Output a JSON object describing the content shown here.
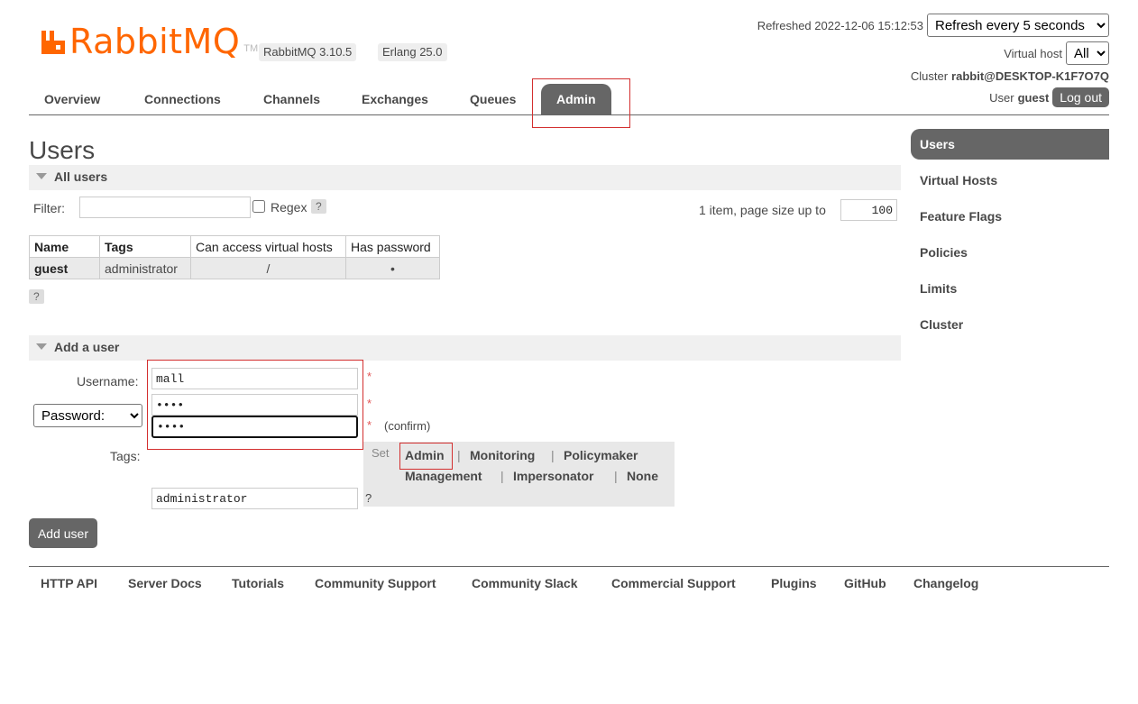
{
  "app": {
    "brand": "RabbitMQ",
    "trademark": "TM",
    "version": "RabbitMQ 3.10.5",
    "erlang": "Erlang 25.0"
  },
  "header": {
    "refreshed_label": "Refreshed 2022-12-06 15:12:53",
    "refresh_option": "Refresh every 5 seconds",
    "vhost_label": "Virtual host",
    "vhost_value": "All",
    "cluster_label": "Cluster",
    "cluster_value": "rabbit@DESKTOP-K1F7O7Q",
    "user_label": "User",
    "user_value": "guest",
    "logout_label": "Log out"
  },
  "tabs": [
    "Overview",
    "Connections",
    "Channels",
    "Exchanges",
    "Queues",
    "Admin"
  ],
  "page_title": "Users",
  "all_users": {
    "header": "All users",
    "filter_label": "Filter:",
    "filter_value": "",
    "regex_label": "Regex",
    "help": "?",
    "paging_label": "1 item, page size up to",
    "page_size": "100",
    "columns": [
      "Name",
      "Tags",
      "Can access virtual hosts",
      "Has password"
    ],
    "rows": [
      {
        "name": "guest",
        "tags": "administrator",
        "vhosts": "/",
        "has_password": "•"
      }
    ]
  },
  "add_user": {
    "header": "Add a user",
    "username_label": "Username:",
    "username_value": "mall",
    "password_mode": "Password:",
    "password_value": "mall",
    "confirm_label": "(confirm)",
    "required": "*",
    "tags_label": "Tags:",
    "set_label": "Set",
    "tag_options": [
      "Admin",
      "Monitoring",
      "Policymaker",
      "Management",
      "Impersonator",
      "None"
    ],
    "separator": "|",
    "tags_value": "administrator",
    "submit_label": "Add user"
  },
  "sidebar": [
    "Users",
    "Virtual Hosts",
    "Feature Flags",
    "Policies",
    "Limits",
    "Cluster"
  ],
  "footer": [
    "HTTP API",
    "Server Docs",
    "Tutorials",
    "Community Support",
    "Community Slack",
    "Commercial Support",
    "Plugins",
    "GitHub",
    "Changelog"
  ],
  "colors": {
    "brand": "#ff6600",
    "highlight": "#d32f2f",
    "tab_active": "#666666"
  }
}
